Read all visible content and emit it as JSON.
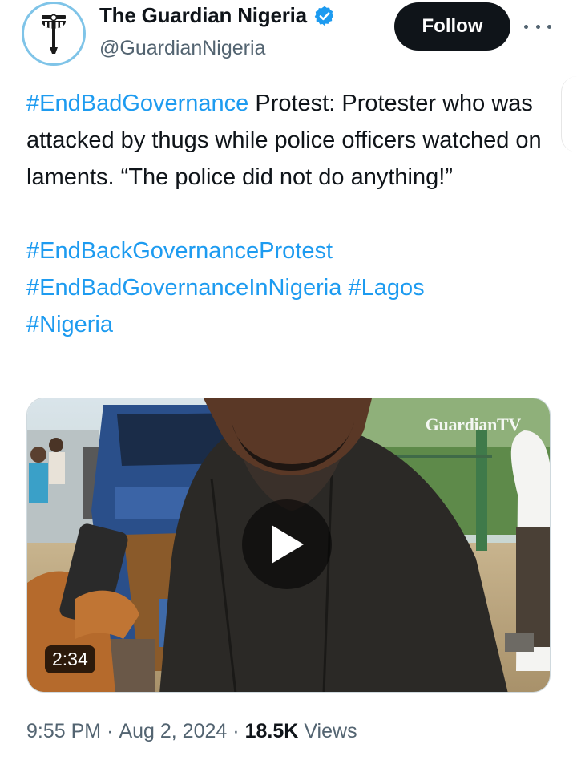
{
  "account": {
    "display_name": "The Guardian Nigeria",
    "handle": "@GuardianNigeria",
    "verified": true,
    "verified_icon": "verified-badge-icon",
    "verified_color": "#1d9bf0",
    "avatar_icon": "guardian-logo-icon"
  },
  "actions": {
    "follow_label": "Follow",
    "more_icon": "more-options-icon"
  },
  "tweet": {
    "segments": [
      {
        "text": "#EndBadGovernance",
        "hashtag": true
      },
      {
        "text": " Protest: Protester who was attacked by thugs while police officers watched on laments. “The police did not do anything!”",
        "hashtag": false
      }
    ],
    "hashtags": [
      "#EndBackGovernanceProtest",
      "#EndBadGovernanceInNigeria",
      "#Lagos",
      "#Nigeria"
    ]
  },
  "media": {
    "type": "video",
    "watermark": "GuardianTV",
    "duration": "2:34",
    "play_icon": "play-icon"
  },
  "meta": {
    "time": "9:55 PM",
    "date": "Aug 2, 2024",
    "views_count": "18.5K",
    "views_label": "Views"
  },
  "colors": {
    "link": "#1d9bf0",
    "text": "#0f1419",
    "secondary": "#536471",
    "follow_bg": "#0f1419"
  }
}
